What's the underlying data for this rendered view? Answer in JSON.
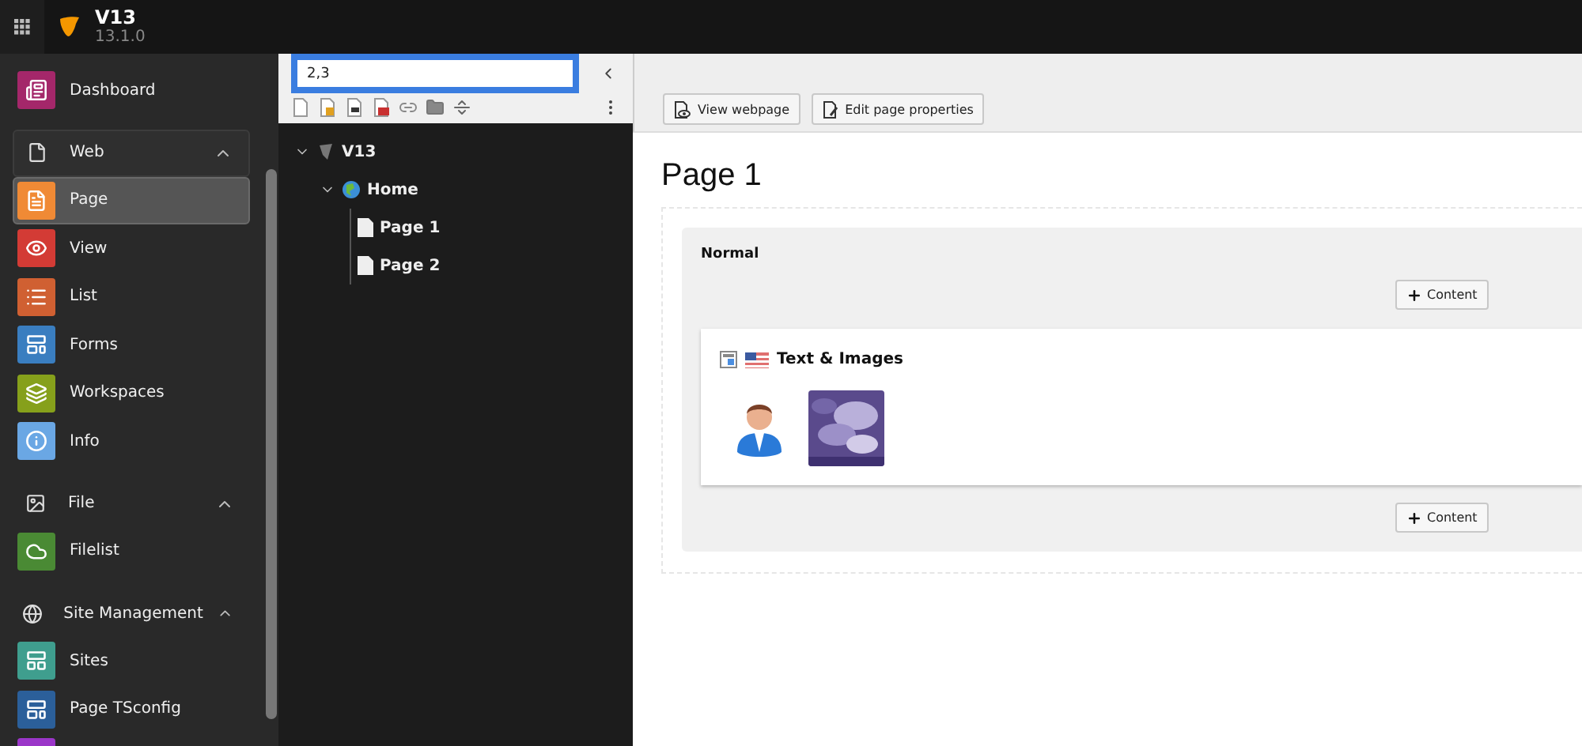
{
  "topbar": {
    "site_name": "V13",
    "version": "13.1.0"
  },
  "sidebar": {
    "items": [
      {
        "kind": "module",
        "label": "Dashboard",
        "color": "#a4276a",
        "selected": false
      },
      {
        "kind": "group",
        "label": "Web",
        "expanded": true
      },
      {
        "kind": "module",
        "label": "Page",
        "color": "#f08a35",
        "selected": true
      },
      {
        "kind": "module",
        "label": "View",
        "color": "#d33b35",
        "selected": false
      },
      {
        "kind": "module",
        "label": "List",
        "color": "#d06032",
        "selected": false
      },
      {
        "kind": "module",
        "label": "Forms",
        "color": "#3a7ec0",
        "selected": false
      },
      {
        "kind": "module",
        "label": "Workspaces",
        "color": "#86a01b",
        "selected": false
      },
      {
        "kind": "module",
        "label": "Info",
        "color": "#6aa7e4",
        "selected": false
      },
      {
        "kind": "group",
        "label": "File",
        "expanded": true
      },
      {
        "kind": "module",
        "label": "Filelist",
        "color": "#4a8a34",
        "selected": false
      },
      {
        "kind": "group",
        "label": "Site Management",
        "expanded": true
      },
      {
        "kind": "module",
        "label": "Sites",
        "color": "#3f9e8e",
        "selected": false
      },
      {
        "kind": "module",
        "label": "Page TSconfig",
        "color": "#2b5f9a",
        "selected": false
      },
      {
        "kind": "module",
        "color": "#9b36c9",
        "selected": false
      }
    ]
  },
  "page_tree": {
    "filter": {
      "value": "2,3"
    },
    "nodes": [
      {
        "label": "V13",
        "expanded": true,
        "children": [
          {
            "label": "Home",
            "expanded": true,
            "children": [
              {
                "label": "Page 1"
              },
              {
                "label": "Page 2"
              }
            ]
          }
        ]
      }
    ]
  },
  "doc_header": {
    "buttons": [
      "View webpage",
      "Edit page properties"
    ]
  },
  "page": {
    "title": "Page 1",
    "column": {
      "title": "Normal",
      "add_label_top": "Content",
      "add_label_bottom": "Content",
      "element": {
        "title": "Text & Images"
      }
    }
  }
}
